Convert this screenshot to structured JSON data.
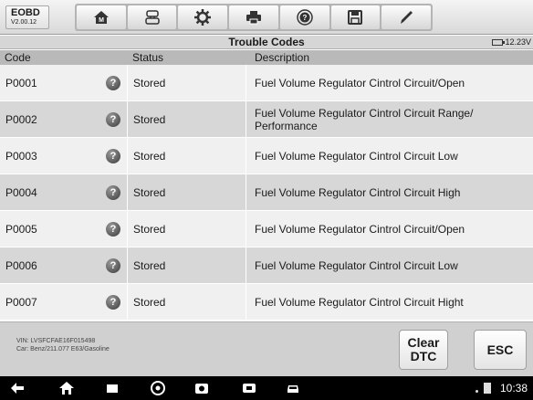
{
  "app": {
    "name": "EOBD",
    "version": "V2.00.12"
  },
  "toolbar": {
    "buttons": [
      {
        "icon": "home-icon"
      },
      {
        "icon": "vehicle-swap-icon"
      },
      {
        "icon": "settings-icon"
      },
      {
        "icon": "print-icon"
      },
      {
        "icon": "help-icon"
      },
      {
        "icon": "save-icon"
      },
      {
        "icon": "pen-icon"
      }
    ]
  },
  "title": "Trouble Codes",
  "battery_voltage": "12.23V",
  "table": {
    "headers": {
      "code": "Code",
      "status": "Status",
      "description": "Description"
    },
    "rows": [
      {
        "code": "P0001",
        "status": "Stored",
        "description": "Fuel Volume Regulator Cintrol Circuit/Open"
      },
      {
        "code": "P0002",
        "status": "Stored",
        "description": "Fuel Volume Regulator Cintrol Circuit Range/ Performance"
      },
      {
        "code": "P0003",
        "status": "Stored",
        "description": "Fuel Volume Regulator Cintrol Circuit Low"
      },
      {
        "code": "P0004",
        "status": "Stored",
        "description": "Fuel Volume Regulator Cintrol Circuit High"
      },
      {
        "code": "P0005",
        "status": "Stored",
        "description": "Fuel Volume Regulator Cintrol Circuit/Open"
      },
      {
        "code": "P0006",
        "status": "Stored",
        "description": "Fuel Volume Regulator Cintrol Circuit Low"
      },
      {
        "code": "P0007",
        "status": "Stored",
        "description": "Fuel Volume Regulator Cintrol Circuit Hight"
      }
    ]
  },
  "footer": {
    "vin": "VIN: LVSFCFAE16F015498",
    "car": "Car: Benz/211.077 E63/Gasoline",
    "clear_dtc_line1": "Clear",
    "clear_dtc_line2": "DTC",
    "esc_label": "ESC"
  },
  "status_bar": {
    "time": "10:38"
  },
  "nav_icons": [
    "back-icon",
    "home-icon",
    "recent-apps-icon",
    "browser-icon",
    "camera-icon",
    "vci-icon",
    "car-icon"
  ]
}
